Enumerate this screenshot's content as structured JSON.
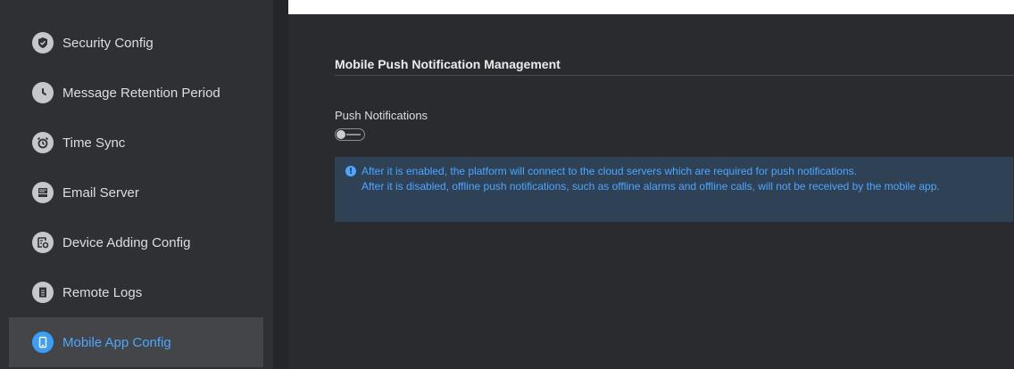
{
  "sidebar": {
    "items": [
      {
        "label": "Security Config",
        "icon": "shield-icon",
        "active": false
      },
      {
        "label": "Message Retention Period",
        "icon": "clock-icon",
        "active": false
      },
      {
        "label": "Time Sync",
        "icon": "alarm-clock-icon",
        "active": false
      },
      {
        "label": "Email Server",
        "icon": "email-icon",
        "active": false
      },
      {
        "label": "Device Adding Config",
        "icon": "device-config-icon",
        "active": false
      },
      {
        "label": "Remote Logs",
        "icon": "document-icon",
        "active": false
      },
      {
        "label": "Mobile App Config",
        "icon": "mobile-icon",
        "active": true
      }
    ]
  },
  "main": {
    "section_title": "Mobile Push Notification Management",
    "push_label": "Push Notifications",
    "push_enabled": false,
    "info_lines": [
      "After it is enabled, the platform will connect to the cloud servers which are required for push notifications.",
      "After it is disabled, offline push notifications, such as offline alarms and offline calls, will not be received by the mobile app."
    ]
  },
  "colors": {
    "accent": "#4da6ff",
    "sidebar_bg": "#2f3033",
    "main_bg": "#2a2b2f",
    "info_bg": "#2f4155"
  }
}
